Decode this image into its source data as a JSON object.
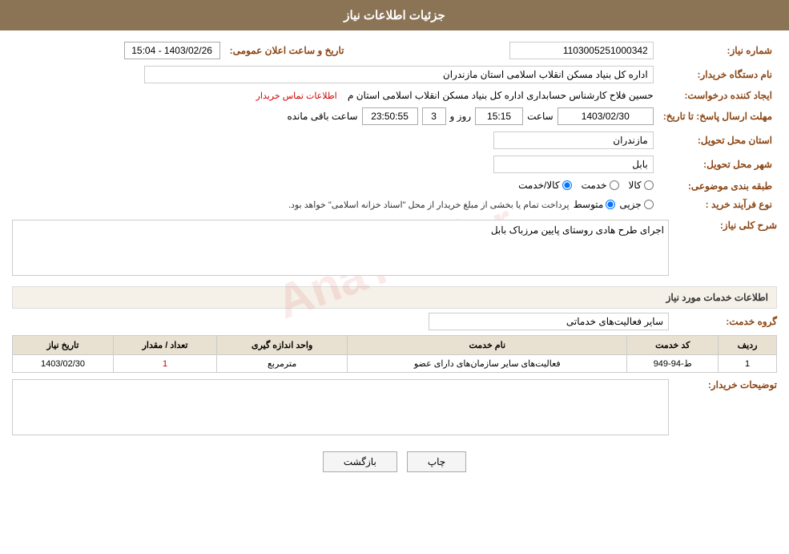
{
  "header": {
    "title": "جزئیات اطلاعات نیاز"
  },
  "fields": {
    "shomareNiaz_label": "شماره نیاز:",
    "shomareNiaz_value": "1103005251000342",
    "namDastgah_label": "نام دستگاه خریدار:",
    "namDastgah_value": "اداره کل بنیاد مسکن انقلاب اسلامی استان مازندران",
    "tarikh_label": "تاریخ و ساعت اعلان عمومی:",
    "tarikh_value": "1403/02/26 - 15:04",
    "ijadKonande_label": "ایجاد کننده درخواست:",
    "ijadKonande_value": "حسین فلاح کارشناس حسابداری اداره کل بنیاد مسکن انقلاب اسلامی استان م",
    "contactLink": "اطلاعات تماس خریدار",
    "mohlat_label": "مهلت ارسال پاسخ: تا تاریخ:",
    "mohlat_date": "1403/02/30",
    "mohlat_saaat_label": "ساعت",
    "mohlat_saat_value": "15:15",
    "mohlat_rooz_label": "روز و",
    "mohlat_rooz_value": "3",
    "mohlat_baghi_value": "23:50:55",
    "mohlat_baghi_label": "ساعت باقی مانده",
    "ostan_label": "استان محل تحویل:",
    "ostan_value": "مازندران",
    "shahr_label": "شهر محل تحویل:",
    "shahr_value": "بابل",
    "tabaghebandi_label": "طبقه بندی موضوعی:",
    "radio_kala": "کالا",
    "radio_khedmat": "خدمت",
    "radio_kala_khedmat": "کالا/خدمت",
    "noeFarayand_label": "نوع فرآیند خرید :",
    "radio_jozei": "جزیی",
    "radio_motevaset": "متوسط",
    "noeFarayand_desc": "پرداخت تمام یا بخشی از مبلغ خریدار از محل \"اسناد خزانه اسلامی\" خواهد بود.",
    "sharh_label": "شرح کلی نیاز:",
    "sharh_value": "اجرای طرح هادی روستای پایین مرزباک بابل",
    "khedamat_section": "اطلاعات خدمات مورد نیاز",
    "grooh_khedmat_label": "گروه خدمت:",
    "grooh_khedmat_value": "سایر فعالیت‌های خدماتی",
    "table": {
      "headers": [
        "ردیف",
        "کد خدمت",
        "نام خدمت",
        "واحد اندازه گیری",
        "تعداد / مقدار",
        "تاریخ نیاز"
      ],
      "rows": [
        {
          "radif": "1",
          "kod": "ط-94-949",
          "name": "فعالیت‌های سایر سازمان‌های دارای عضو",
          "vahed": "مترمربع",
          "tedad": "1",
          "tarikh": "1403/02/30"
        }
      ]
    },
    "tozihat_label": "توضیحات خریدار:",
    "tozihat_value": ""
  },
  "buttons": {
    "print_label": "چاپ",
    "back_label": "بازگشت"
  }
}
